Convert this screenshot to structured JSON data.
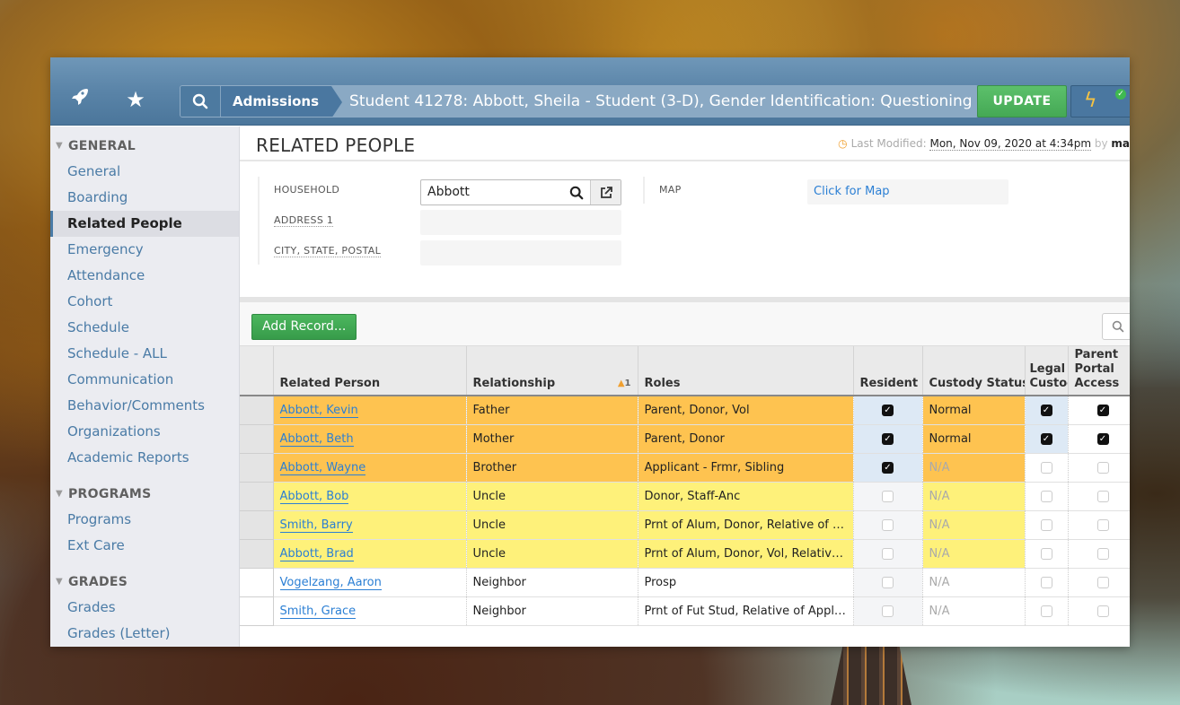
{
  "topbar": {
    "module": "Admissions",
    "title": "Student 41278: Abbott, Sheila - Student (3-D), Gender Identification: Questioning",
    "update_label": "UPDATE",
    "icons": {
      "rocket": "rocket-icon",
      "star": "star-icon",
      "search": "search-icon",
      "bolt": "lightning-icon",
      "status": "check-circle-icon"
    }
  },
  "sidebar": {
    "sections": [
      {
        "label": "GENERAL",
        "items": [
          "General",
          "Boarding",
          "Related People",
          "Emergency",
          "Attendance",
          "Cohort",
          "Schedule",
          "Schedule - ALL",
          "Communication",
          "Behavior/Comments",
          "Organizations",
          "Academic Reports"
        ]
      },
      {
        "label": "PROGRAMS",
        "items": [
          "Programs",
          "Ext Care"
        ]
      },
      {
        "label": "GRADES",
        "items": [
          "Grades",
          "Grades (Letter)"
        ]
      }
    ],
    "active_item": "Related People"
  },
  "page": {
    "title": "RELATED PEOPLE",
    "last_modified_label": "Last Modified:",
    "last_modified_date": "Mon, Nov 09, 2020 at 4:34pm",
    "by_label": "by",
    "by_user": "ma"
  },
  "form": {
    "household_label": "HOUSEHOLD",
    "household_value": "Abbott",
    "address1_label": "ADDRESS 1",
    "address1_value": "",
    "city_label": "CITY, STATE, POSTAL",
    "city_value": "",
    "map_label": "MAP",
    "map_link": "Click for Map"
  },
  "toolbar": {
    "add_label": "Add Record..."
  },
  "table": {
    "headers": {
      "person": "Related Person",
      "relationship": "Relationship",
      "sort_indicator": "1",
      "roles": "Roles",
      "resident": "Resident",
      "custody": "Custody Status",
      "legal": "Legal Custody",
      "portal": "Parent Portal Access"
    },
    "rows": [
      {
        "person": "Abbott, Kevin",
        "relationship": "Father",
        "roles": "Parent, Donor, Vol",
        "resident": true,
        "custody": "Normal",
        "legal": true,
        "portal": true,
        "highlight": "orange"
      },
      {
        "person": "Abbott, Beth",
        "relationship": "Mother",
        "roles": "Parent, Donor",
        "resident": true,
        "custody": "Normal",
        "legal": true,
        "portal": true,
        "highlight": "orange"
      },
      {
        "person": "Abbott, Wayne",
        "relationship": "Brother",
        "roles": "Applicant - Frmr, Sibling",
        "resident": true,
        "custody": "N/A",
        "legal": false,
        "portal": false,
        "highlight": "orange"
      },
      {
        "person": "Abbott, Bob",
        "relationship": "Uncle",
        "roles": "Donor, Staff-Anc",
        "resident": false,
        "custody": "N/A",
        "legal": false,
        "portal": false,
        "highlight": "yellow"
      },
      {
        "person": "Smith, Barry",
        "relationship": "Uncle",
        "roles": "Prnt of Alum, Donor, Relative of …",
        "resident": false,
        "custody": "N/A",
        "legal": false,
        "portal": false,
        "highlight": "yellow"
      },
      {
        "person": "Abbott, Brad",
        "relationship": "Uncle",
        "roles": "Prnt of Alum, Donor, Vol, Relativ…",
        "resident": false,
        "custody": "N/A",
        "legal": false,
        "portal": false,
        "highlight": "yellow"
      },
      {
        "person": "Vogelzang, Aaron",
        "relationship": "Neighbor",
        "roles": "Prosp",
        "resident": false,
        "custody": "N/A",
        "legal": false,
        "portal": false,
        "highlight": "white"
      },
      {
        "person": "Smith, Grace",
        "relationship": "Neighbor",
        "roles": "Prnt of Fut Stud, Relative of Appl…",
        "resident": false,
        "custody": "N/A",
        "legal": false,
        "portal": false,
        "highlight": "white"
      }
    ]
  },
  "colors": {
    "topbar": "#5a84a8",
    "accent_green": "#45a955",
    "link_blue": "#2b7fd4",
    "row_orange": "#fec350",
    "row_yellow": "#fef17a"
  }
}
